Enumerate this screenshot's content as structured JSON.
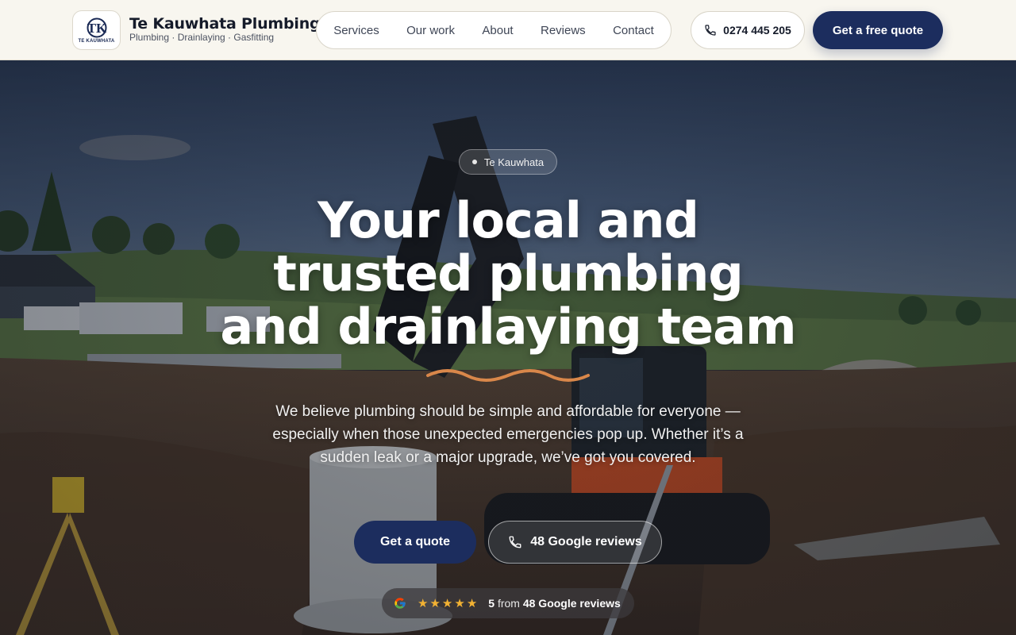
{
  "header": {
    "logo_mark": "TK",
    "logo_text": "TE KAUWHATA",
    "brand_name": "Te Kauwhata Plumbing",
    "brand_tagline": "Plumbing · Drainlaying · Gasfitting",
    "nav": [
      "Services",
      "Our work",
      "About",
      "Reviews",
      "Contact"
    ],
    "phone": "0274 445 205",
    "phone_icon": "phone-icon",
    "quote_button": "Get a free quote"
  },
  "hero": {
    "badge": "Te Kauwhata",
    "headline_lines": [
      "Your local and",
      "trusted plumbing",
      "and drainlaying team"
    ],
    "subtext": "We believe plumbing should be simple and affordable for everyone — especially when those unexpected emergencies pop up. Whether it’s a sudden leak or a major upgrade, we’ve got you covered.",
    "cta_primary": "Get a quote",
    "cta_secondary": "48 Google reviews",
    "cta_secondary_icon": "phone-icon"
  },
  "rating": {
    "icon": "google-icon",
    "stars": 5,
    "score": "5",
    "from": "from",
    "reviews_label": "48 Google reviews"
  },
  "colors": {
    "primary": "#1c2d5e",
    "header_bg": "#f8f6ef",
    "accent_squiggle": "#d9874a",
    "star": "#f2b233"
  }
}
